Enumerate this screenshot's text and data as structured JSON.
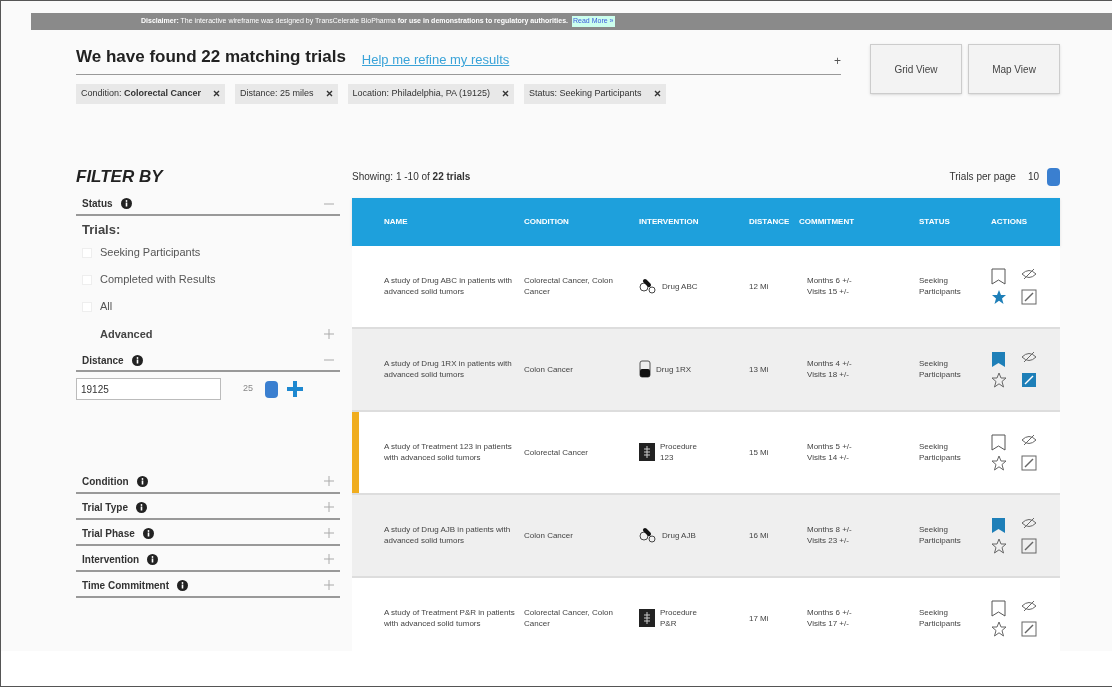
{
  "disclaimer": {
    "text": "**Disclaimer:** The interactive wireframe was designed by TransCelerate BioPharma **for use in demonstrations to regulatory authorities.**",
    "link": "Read More »"
  },
  "header": {
    "title": "We have found 22 matching trials",
    "refine_placeholder": "Help me refine my results",
    "refine_icon": "+"
  },
  "view_buttons": [
    {
      "label": "Grid View",
      "selected": false
    },
    {
      "label": "Map View",
      "selected": false
    }
  ],
  "chips": [
    {
      "text": "Condition: **Colorectal Cancer**"
    },
    {
      "text": "Distance: 25 miles"
    },
    {
      "text": "Location: Philadelphia, PA (19125)"
    },
    {
      "text": "Status: Seeking Participants"
    }
  ],
  "sidebar": {
    "title": "FILTER BY",
    "sections": [
      {
        "kind": "status",
        "label": "Status",
        "expanded": true,
        "group_label": "Trials:",
        "options": [
          {
            "label": "Seeking Participants",
            "checked": false
          },
          {
            "label": "Completed with Results",
            "checked": false
          },
          {
            "label": "All",
            "checked": false
          }
        ],
        "advanced": {
          "label": "Advanced",
          "expanded": false
        }
      },
      {
        "kind": "distance",
        "label": "Distance",
        "expanded": true,
        "zip": "19125",
        "miles": "25"
      },
      {
        "kind": "plain",
        "label": "Condition",
        "expanded": false
      },
      {
        "kind": "plain",
        "label": "Trial Type",
        "expanded": false
      },
      {
        "kind": "plain",
        "label": "Trial Phase",
        "expanded": false
      },
      {
        "kind": "plain",
        "label": "Intervention",
        "expanded": false
      },
      {
        "kind": "plain",
        "label": "Time Commitment",
        "expanded": false
      }
    ]
  },
  "results": {
    "showing": "Showing: 1 -10 of **22 trials**",
    "per_page_label": "Trials per page",
    "per_page": "10"
  },
  "table": {
    "columns": [
      "NAME",
      "CONDITION",
      "INTERVENTION",
      "DISTANCE",
      "COMMITMENT",
      "STATUS",
      "ACTIONS"
    ],
    "rows": [
      {
        "name": "A study of Drug ABC in patients with advanced solid tumors",
        "condition": "Colorectal Cancer, Colon Cancer",
        "intervention": {
          "kind": "pill",
          "label": "Drug ABC"
        },
        "distance": "12 Mi",
        "commitment": [
          "Months 6 +/-",
          "Visits 15 +/-"
        ],
        "status": "Seeking Participants",
        "highlighted": false,
        "bookmarked": false,
        "starred": true,
        "edit_active": false
      },
      {
        "name": "A study of Drug 1RX in patients with advanced solid tumors",
        "condition": "Colon Cancer",
        "intervention": {
          "kind": "vial",
          "label": "Drug 1RX"
        },
        "distance": "13 Mi",
        "commitment": [
          "Months 4 +/-",
          "Visits 18 +/-"
        ],
        "status": "Seeking Participants",
        "highlighted": false,
        "bookmarked": true,
        "starred": false,
        "edit_active": true
      },
      {
        "name": "A study of Treatment 123 in patients with advanced solid tumors",
        "condition": "Colorectal Cancer",
        "intervention": {
          "kind": "procedure",
          "label": "Procedure 123"
        },
        "distance": "15 Mi",
        "commitment": [
          "Months 5 +/-",
          "Visits 14 +/-"
        ],
        "status": "Seeking Participants",
        "highlighted": true,
        "bookmarked": false,
        "starred": false,
        "edit_active": false
      },
      {
        "name": "A study of Drug AJB in patients with advanced solid tumors",
        "condition": "Colon Cancer",
        "intervention": {
          "kind": "pill",
          "label": "Drug AJB"
        },
        "distance": "16 Mi",
        "commitment": [
          "Months 8 +/-",
          "Visits 23 +/-"
        ],
        "status": "Seeking Participants",
        "highlighted": false,
        "bookmarked": true,
        "starred": false,
        "edit_active": false
      },
      {
        "name": "A study of Treatment P&R in patients with advanced solid tumors",
        "condition": "Colorectal Cancer, Colon Cancer",
        "intervention": {
          "kind": "procedure",
          "label": "Procedure P&R"
        },
        "distance": "17 Mi",
        "commitment": [
          "Months 6 +/-",
          "Visits 17 +/-"
        ],
        "status": "Seeking Participants",
        "highlighted": false,
        "bookmarked": false,
        "starred": false,
        "edit_active": false
      }
    ]
  }
}
